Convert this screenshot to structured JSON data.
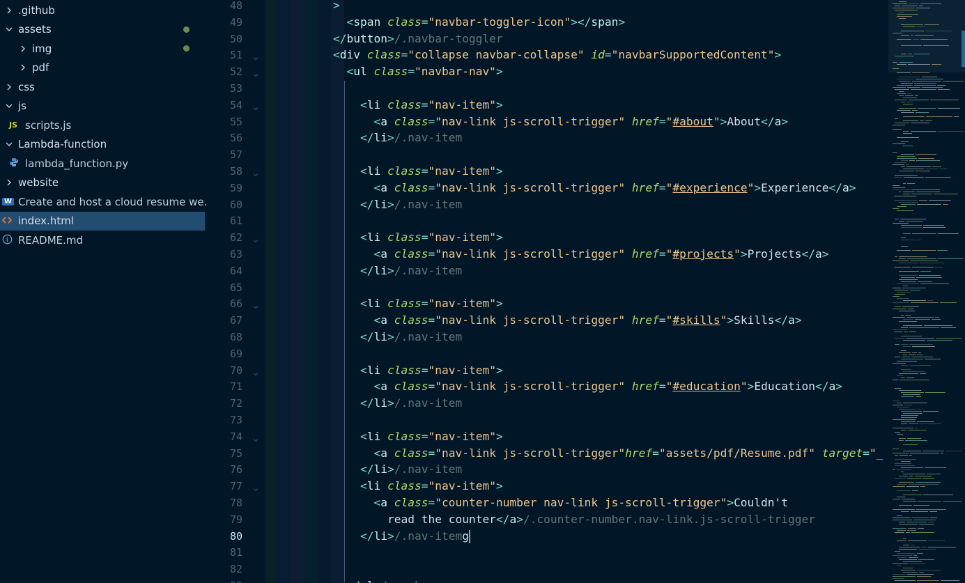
{
  "explorer": {
    "items": [
      {
        "label": ".github",
        "type": "folder",
        "expanded": false,
        "depth": 0
      },
      {
        "label": "assets",
        "type": "folder",
        "expanded": true,
        "depth": 0,
        "modified": true
      },
      {
        "label": "img",
        "type": "folder",
        "expanded": false,
        "depth": 1,
        "modified": true
      },
      {
        "label": "pdf",
        "type": "folder",
        "expanded": false,
        "depth": 1
      },
      {
        "label": "css",
        "type": "folder",
        "expanded": false,
        "depth": 0
      },
      {
        "label": "js",
        "type": "folder",
        "expanded": true,
        "depth": 0
      },
      {
        "label": "scripts.js",
        "type": "file",
        "icon": "js-file-icon",
        "icon_text": "JS",
        "depth": 1
      },
      {
        "label": "Lambda-function",
        "type": "folder",
        "expanded": true,
        "depth": 0
      },
      {
        "label": "lambda_function.py",
        "type": "file",
        "icon": "python-file-icon",
        "depth": 1
      },
      {
        "label": "website",
        "type": "folder",
        "expanded": false,
        "depth": 0
      },
      {
        "label": "Create and host a cloud resume we...",
        "type": "file",
        "icon": "word-file-icon",
        "icon_text": "W",
        "depth": 0
      },
      {
        "label": "index.html",
        "type": "file",
        "icon": "html-file-icon",
        "depth": 0,
        "selected": true
      },
      {
        "label": "README.md",
        "type": "file",
        "icon": "info-icon",
        "depth": 0
      }
    ]
  },
  "editor": {
    "active_line": 80,
    "lines": [
      {
        "n": 48,
        "fold": false,
        "indent": 0,
        "tokens": [
          [
            "punc",
            ">"
          ]
        ]
      },
      {
        "n": 49,
        "fold": false,
        "indent": 1,
        "tokens": [
          [
            "punc",
            "<"
          ],
          [
            "tag",
            "span "
          ],
          [
            "attr",
            "class"
          ],
          [
            "punc",
            "="
          ],
          [
            "str",
            "\"navbar-toggler-icon\""
          ],
          [
            "punc",
            "></"
          ],
          [
            "tag",
            "span"
          ],
          [
            "punc",
            ">"
          ]
        ]
      },
      {
        "n": 50,
        "fold": false,
        "indent": 0,
        "tokens": [
          [
            "punc",
            "</"
          ],
          [
            "tag",
            "button"
          ],
          [
            "punc",
            ">"
          ],
          [
            "cmt",
            "/.navbar-toggler"
          ]
        ]
      },
      {
        "n": 51,
        "fold": true,
        "indent": 0,
        "tokens": [
          [
            "punc",
            "<"
          ],
          [
            "tag",
            "div "
          ],
          [
            "attr",
            "class"
          ],
          [
            "punc",
            "="
          ],
          [
            "str",
            "\"collapse navbar-collapse\" "
          ],
          [
            "attr",
            "id"
          ],
          [
            "punc",
            "="
          ],
          [
            "str",
            "\"navbarSupportedContent\""
          ],
          [
            "punc",
            ">"
          ]
        ]
      },
      {
        "n": 52,
        "fold": true,
        "indent": 1,
        "tokens": [
          [
            "punc",
            "<"
          ],
          [
            "tag",
            "ul "
          ],
          [
            "attr",
            "class"
          ],
          [
            "punc",
            "="
          ],
          [
            "str",
            "\"navbar-nav\""
          ],
          [
            "punc",
            ">"
          ]
        ]
      },
      {
        "n": 53,
        "fold": false,
        "indent": 0,
        "tokens": []
      },
      {
        "n": 54,
        "fold": true,
        "indent": 2,
        "tokens": [
          [
            "punc",
            "<"
          ],
          [
            "tag",
            "li "
          ],
          [
            "attr",
            "class"
          ],
          [
            "punc",
            "="
          ],
          [
            "str",
            "\"nav-item\""
          ],
          [
            "punc",
            ">"
          ]
        ]
      },
      {
        "n": 55,
        "fold": false,
        "indent": 3,
        "tokens": [
          [
            "punc",
            "<"
          ],
          [
            "tag",
            "a "
          ],
          [
            "attr",
            "class"
          ],
          [
            "punc",
            "="
          ],
          [
            "str",
            "\"nav-link js-scroll-trigger\" "
          ],
          [
            "attr",
            "href"
          ],
          [
            "punc",
            "="
          ],
          [
            "str",
            "\""
          ],
          [
            "link",
            "#about"
          ],
          [
            "str",
            "\""
          ],
          [
            "punc",
            ">"
          ],
          [
            "txt",
            "About"
          ],
          [
            "punc",
            "</"
          ],
          [
            "tag",
            "a"
          ],
          [
            "punc",
            ">"
          ]
        ]
      },
      {
        "n": 56,
        "fold": false,
        "indent": 2,
        "tokens": [
          [
            "punc",
            "</"
          ],
          [
            "tag",
            "li"
          ],
          [
            "punc",
            ">"
          ],
          [
            "cmt",
            "/.nav-item"
          ]
        ]
      },
      {
        "n": 57,
        "fold": false,
        "indent": 0,
        "tokens": []
      },
      {
        "n": 58,
        "fold": true,
        "indent": 2,
        "tokens": [
          [
            "punc",
            "<"
          ],
          [
            "tag",
            "li "
          ],
          [
            "attr",
            "class"
          ],
          [
            "punc",
            "="
          ],
          [
            "str",
            "\"nav-item\""
          ],
          [
            "punc",
            ">"
          ]
        ]
      },
      {
        "n": 59,
        "fold": false,
        "indent": 3,
        "tokens": [
          [
            "punc",
            "<"
          ],
          [
            "tag",
            "a "
          ],
          [
            "attr",
            "class"
          ],
          [
            "punc",
            "="
          ],
          [
            "str",
            "\"nav-link js-scroll-trigger\" "
          ],
          [
            "attr",
            "href"
          ],
          [
            "punc",
            "="
          ],
          [
            "str",
            "\""
          ],
          [
            "link",
            "#experience"
          ],
          [
            "str",
            "\""
          ],
          [
            "punc",
            ">"
          ],
          [
            "txt",
            "Experience"
          ],
          [
            "punc",
            "</"
          ],
          [
            "tag",
            "a"
          ],
          [
            "punc",
            ">"
          ]
        ]
      },
      {
        "n": 60,
        "fold": false,
        "indent": 2,
        "tokens": [
          [
            "punc",
            "</"
          ],
          [
            "tag",
            "li"
          ],
          [
            "punc",
            ">"
          ],
          [
            "cmt",
            "/.nav-item"
          ]
        ]
      },
      {
        "n": 61,
        "fold": false,
        "indent": 0,
        "tokens": []
      },
      {
        "n": 62,
        "fold": true,
        "indent": 2,
        "tokens": [
          [
            "punc",
            "<"
          ],
          [
            "tag",
            "li "
          ],
          [
            "attr",
            "class"
          ],
          [
            "punc",
            "="
          ],
          [
            "str",
            "\"nav-item\""
          ],
          [
            "punc",
            ">"
          ]
        ]
      },
      {
        "n": 63,
        "fold": false,
        "indent": 3,
        "tokens": [
          [
            "punc",
            "<"
          ],
          [
            "tag",
            "a "
          ],
          [
            "attr",
            "class"
          ],
          [
            "punc",
            "="
          ],
          [
            "str",
            "\"nav-link js-scroll-trigger\" "
          ],
          [
            "attr",
            "href"
          ],
          [
            "punc",
            "="
          ],
          [
            "str",
            "\""
          ],
          [
            "link",
            "#projects"
          ],
          [
            "str",
            "\""
          ],
          [
            "punc",
            ">"
          ],
          [
            "txt",
            "Projects"
          ],
          [
            "punc",
            "</"
          ],
          [
            "tag",
            "a"
          ],
          [
            "punc",
            ">"
          ]
        ]
      },
      {
        "n": 64,
        "fold": false,
        "indent": 2,
        "tokens": [
          [
            "punc",
            "</"
          ],
          [
            "tag",
            "li"
          ],
          [
            "punc",
            ">"
          ],
          [
            "cmt",
            "/.nav-item"
          ]
        ]
      },
      {
        "n": 65,
        "fold": false,
        "indent": 0,
        "tokens": []
      },
      {
        "n": 66,
        "fold": true,
        "indent": 2,
        "tokens": [
          [
            "punc",
            "<"
          ],
          [
            "tag",
            "li "
          ],
          [
            "attr",
            "class"
          ],
          [
            "punc",
            "="
          ],
          [
            "str",
            "\"nav-item\""
          ],
          [
            "punc",
            ">"
          ]
        ]
      },
      {
        "n": 67,
        "fold": false,
        "indent": 3,
        "tokens": [
          [
            "punc",
            "<"
          ],
          [
            "tag",
            "a "
          ],
          [
            "attr",
            "class"
          ],
          [
            "punc",
            "="
          ],
          [
            "str",
            "\"nav-link js-scroll-trigger\" "
          ],
          [
            "attr",
            "href"
          ],
          [
            "punc",
            "="
          ],
          [
            "str",
            "\""
          ],
          [
            "link",
            "#skills"
          ],
          [
            "str",
            "\""
          ],
          [
            "punc",
            ">"
          ],
          [
            "txt",
            "Skills"
          ],
          [
            "punc",
            "</"
          ],
          [
            "tag",
            "a"
          ],
          [
            "punc",
            ">"
          ]
        ]
      },
      {
        "n": 68,
        "fold": false,
        "indent": 2,
        "tokens": [
          [
            "punc",
            "</"
          ],
          [
            "tag",
            "li"
          ],
          [
            "punc",
            ">"
          ],
          [
            "cmt",
            "/.nav-item"
          ]
        ]
      },
      {
        "n": 69,
        "fold": false,
        "indent": 0,
        "tokens": []
      },
      {
        "n": 70,
        "fold": true,
        "indent": 2,
        "tokens": [
          [
            "punc",
            "<"
          ],
          [
            "tag",
            "li "
          ],
          [
            "attr",
            "class"
          ],
          [
            "punc",
            "="
          ],
          [
            "str",
            "\"nav-item\""
          ],
          [
            "punc",
            ">"
          ]
        ]
      },
      {
        "n": 71,
        "fold": false,
        "indent": 3,
        "tokens": [
          [
            "punc",
            "<"
          ],
          [
            "tag",
            "a "
          ],
          [
            "attr",
            "class"
          ],
          [
            "punc",
            "="
          ],
          [
            "str",
            "\"nav-link js-scroll-trigger\" "
          ],
          [
            "attr",
            "href"
          ],
          [
            "punc",
            "="
          ],
          [
            "str",
            "\""
          ],
          [
            "link",
            "#education"
          ],
          [
            "str",
            "\""
          ],
          [
            "punc",
            ">"
          ],
          [
            "txt",
            "Education"
          ],
          [
            "punc",
            "</"
          ],
          [
            "tag",
            "a"
          ],
          [
            "punc",
            ">"
          ]
        ]
      },
      {
        "n": 72,
        "fold": false,
        "indent": 2,
        "tokens": [
          [
            "punc",
            "</"
          ],
          [
            "tag",
            "li"
          ],
          [
            "punc",
            ">"
          ],
          [
            "cmt",
            "/.nav-item"
          ]
        ]
      },
      {
        "n": 73,
        "fold": false,
        "indent": 0,
        "tokens": []
      },
      {
        "n": 74,
        "fold": true,
        "indent": 2,
        "tokens": [
          [
            "punc",
            "<"
          ],
          [
            "tag",
            "li "
          ],
          [
            "attr",
            "class"
          ],
          [
            "punc",
            "="
          ],
          [
            "str",
            "\"nav-item\""
          ],
          [
            "punc",
            ">"
          ]
        ]
      },
      {
        "n": 75,
        "fold": false,
        "indent": 3,
        "tokens": [
          [
            "punc",
            "<"
          ],
          [
            "tag",
            "a "
          ],
          [
            "attr",
            "class"
          ],
          [
            "punc",
            "="
          ],
          [
            "str",
            "\"nav-link js-scroll-trigger\""
          ],
          [
            "attr",
            "href"
          ],
          [
            "punc",
            "="
          ],
          [
            "str",
            "\"assets/pdf/Resume.pdf\" "
          ],
          [
            "attr",
            "target"
          ],
          [
            "punc",
            "="
          ],
          [
            "str",
            "\"_bl"
          ]
        ]
      },
      {
        "n": 76,
        "fold": false,
        "indent": 2,
        "tokens": [
          [
            "punc",
            "</"
          ],
          [
            "tag",
            "li"
          ],
          [
            "punc",
            ">"
          ],
          [
            "cmt",
            "/.nav-item"
          ]
        ]
      },
      {
        "n": 77,
        "fold": true,
        "indent": 2,
        "tokens": [
          [
            "punc",
            "<"
          ],
          [
            "tag",
            "li "
          ],
          [
            "attr",
            "class"
          ],
          [
            "punc",
            "="
          ],
          [
            "str",
            "\"nav-item\""
          ],
          [
            "punc",
            ">"
          ]
        ]
      },
      {
        "n": 78,
        "fold": false,
        "indent": 3,
        "tokens": [
          [
            "punc",
            "<"
          ],
          [
            "tag",
            "a "
          ],
          [
            "attr",
            "class"
          ],
          [
            "punc",
            "="
          ],
          [
            "str",
            "\"counter-number nav-link js-scroll-trigger\""
          ],
          [
            "punc",
            ">"
          ],
          [
            "txt",
            "Couldn't"
          ]
        ]
      },
      {
        "n": 79,
        "fold": false,
        "indent": 4,
        "tokens": [
          [
            "txt",
            "read the counter"
          ],
          [
            "punc",
            "</"
          ],
          [
            "tag",
            "a"
          ],
          [
            "punc",
            ">"
          ],
          [
            "cmt",
            "/.counter-number.nav-link.js-scroll-trigger"
          ]
        ]
      },
      {
        "n": 80,
        "fold": false,
        "indent": 2,
        "tokens": [
          [
            "punc",
            "</"
          ],
          [
            "tag",
            "li"
          ],
          [
            "punc",
            ">"
          ],
          [
            "cmt",
            "/.nav-item"
          ],
          [
            "txt",
            "g"
          ]
        ]
      },
      {
        "n": 81,
        "fold": false,
        "indent": 0,
        "tokens": []
      },
      {
        "n": 82,
        "fold": false,
        "indent": 0,
        "tokens": []
      },
      {
        "n": 83,
        "fold": false,
        "indent": 1,
        "tokens": [
          [
            "punc",
            "</"
          ],
          [
            "tag",
            "ul"
          ],
          [
            "punc",
            ">"
          ],
          [
            "cmt",
            "/.navbar-nav"
          ]
        ]
      }
    ]
  },
  "colors": {
    "background": "#011627",
    "selection": "#234d70",
    "tag": "#caece6",
    "punctuation": "#7fdbca",
    "attribute": "#addb67",
    "string": "#ecc48d",
    "comment": "#637777",
    "line_number": "#4b6479",
    "active_line_number": "#c5e4fd",
    "git_modified": "#73a35c"
  }
}
